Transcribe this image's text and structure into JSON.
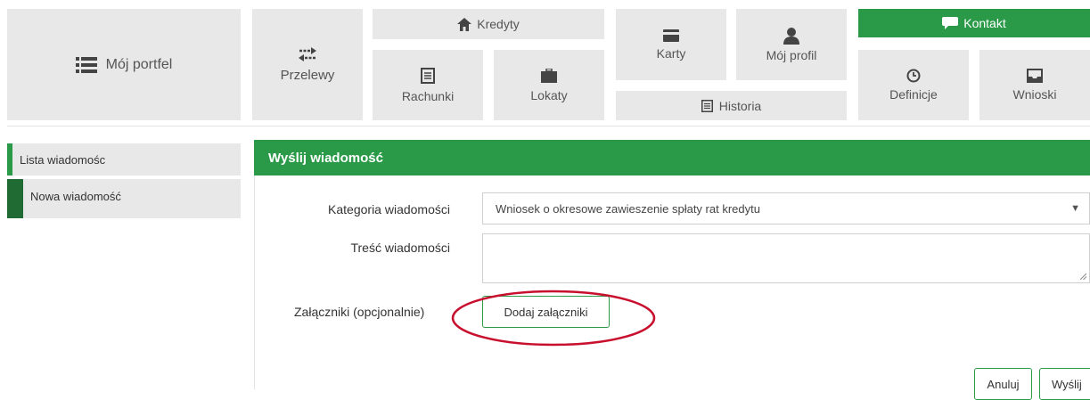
{
  "nav": {
    "portfel": "Mój portfel",
    "przelewy": "Przelewy",
    "kredyty": "Kredyty",
    "rachunki": "Rachunki",
    "lokaty": "Lokaty",
    "karty": "Karty",
    "profil": "Mój profil",
    "historia": "Historia",
    "kontakt": "Kontakt",
    "definicje": "Definicje",
    "wnioski": "Wnioski"
  },
  "sidebar": {
    "items": [
      {
        "label": "Lista wiadomośc"
      },
      {
        "label": "Nowa wiadomość"
      }
    ]
  },
  "form": {
    "title": "Wyślij wiadomość",
    "kategoria_label": "Kategoria wiadomości",
    "kategoria_value": "Wniosek o okresowe zawieszenie spłaty rat kredytu",
    "tresc_label": "Treść wiadomości",
    "tresc_value": "",
    "zalaczniki_label": "Załączniki (opcjonalnie)",
    "add_button": "Dodaj załączniki",
    "cancel_button": "Anuluj",
    "send_button": "Wyślij"
  },
  "colors": {
    "accent": "#2a9a48",
    "accent_dark": "#1f6b33",
    "tile": "#e8e8e8",
    "highlight_ring": "#c8102e"
  },
  "icons": [
    "list-icon",
    "transfer-arrows-icon",
    "home-icon",
    "ledger-icon",
    "briefcase-icon",
    "card-icon",
    "user-icon",
    "chat-bubble-icon",
    "clock-icon",
    "inbox-icon",
    "document-icon"
  ]
}
